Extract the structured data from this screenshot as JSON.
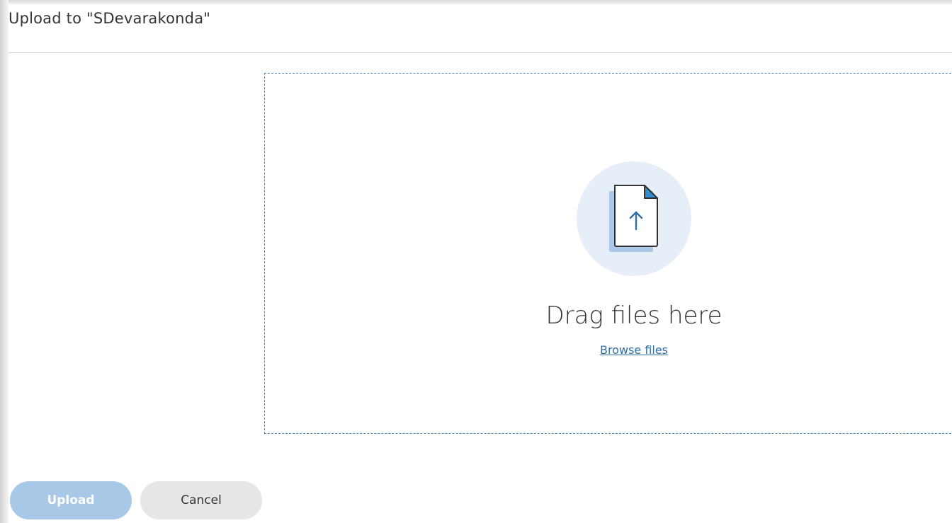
{
  "dialog": {
    "title": "Upload to \"SDevarakonda\""
  },
  "dropzone": {
    "icon": "file-upload-icon",
    "drag_text": "Drag files here",
    "browse_label": "Browse files"
  },
  "actions": {
    "upload_label": "Upload",
    "cancel_label": "Cancel"
  },
  "colors": {
    "accent": "#2f6fa7",
    "dropzone_border": "#4a86b8",
    "circle_bg": "#e6eef8",
    "upload_disabled": "#a8c8e8",
    "cancel_bg": "#e6e6e6"
  }
}
